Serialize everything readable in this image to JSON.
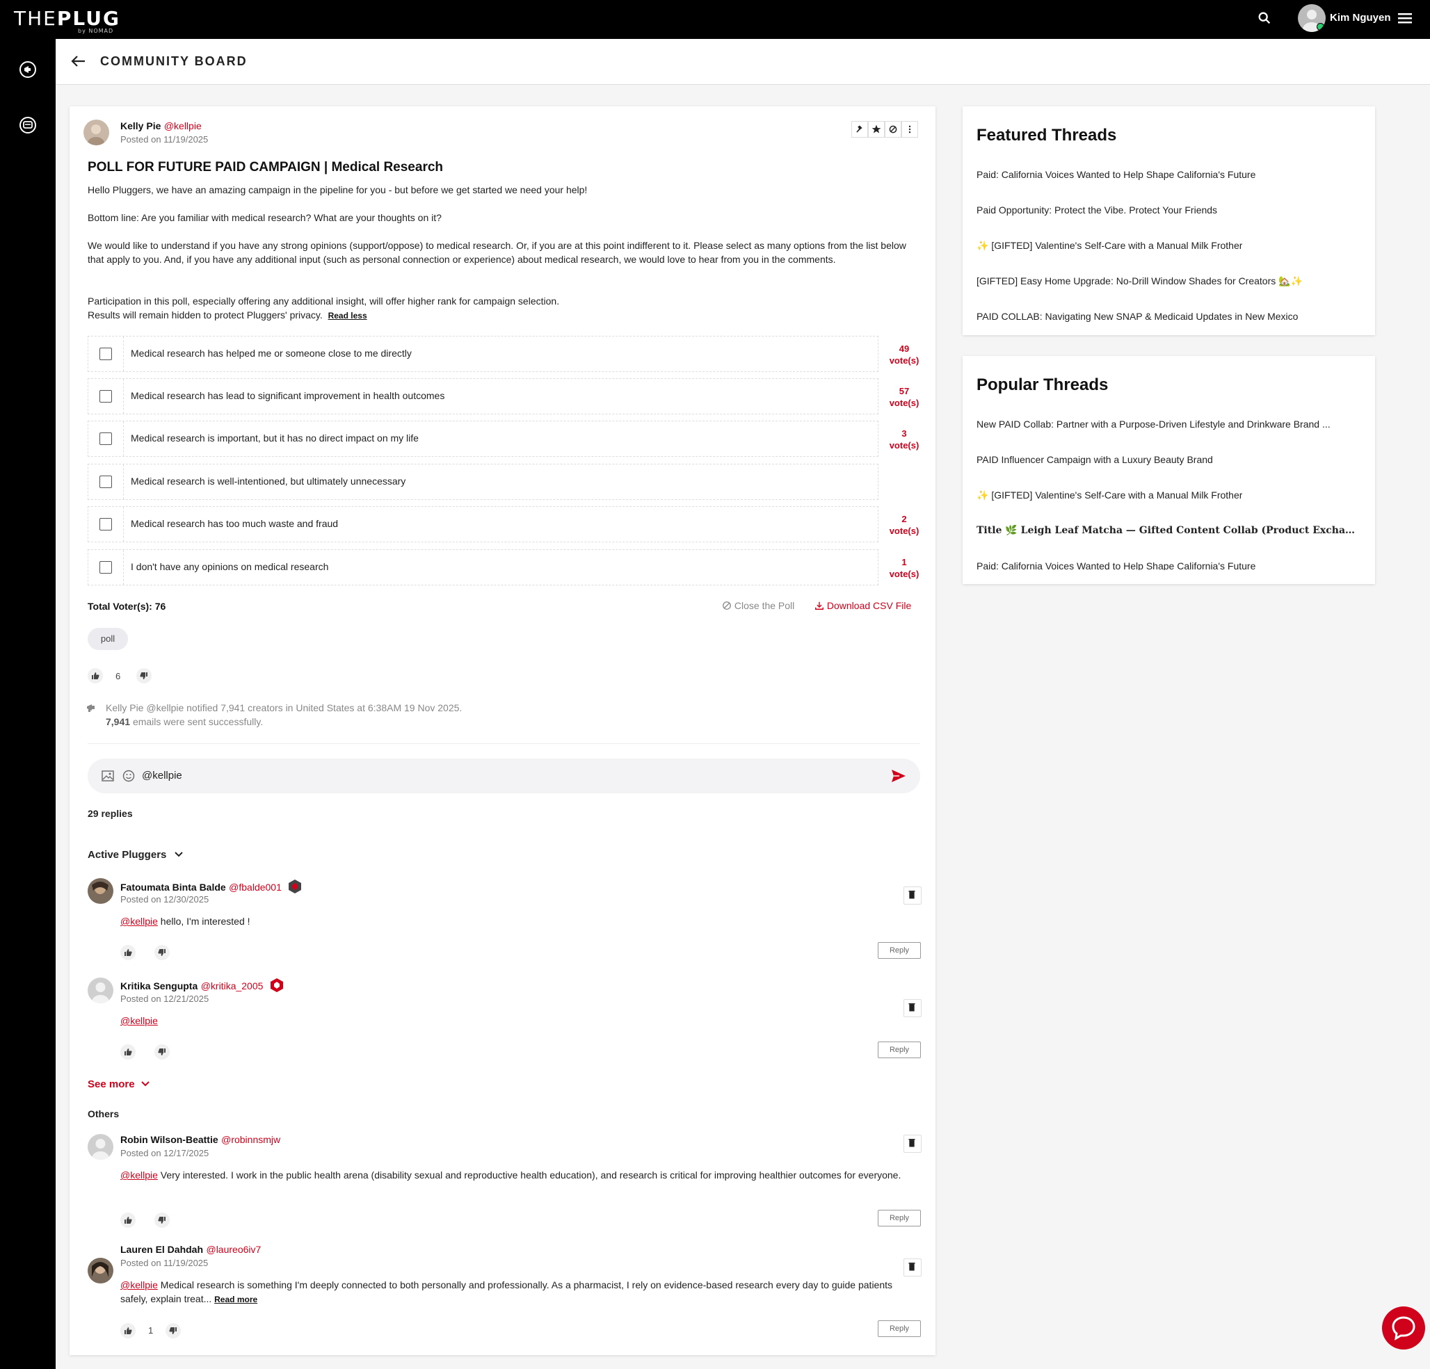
{
  "app": {
    "logo_the": "THE",
    "logo_plug": "PLUG",
    "logo_sub": "by NOMAD",
    "user_name": "Kim Nguyen"
  },
  "header": {
    "title": "COMMUNITY BOARD"
  },
  "post": {
    "author": "Kelly Pie",
    "handle": "@kellpie",
    "posted": "Posted on 11/19/2025",
    "title": "POLL FOR FUTURE PAID CAMPAIGN | Medical Research",
    "p1": "Hello Pluggers, we have an amazing campaign in the pipeline for you - but before we get started we need your help!",
    "p2": "Bottom line: Are you familiar with medical research? What are your thoughts on it?",
    "p3": "We would like to understand if you have any strong opinions (support/oppose) to medical research. Or, if you are at this point indifferent to it. Please select as many options from the list below that apply to you. And, if you have any additional input (such as personal connection or experience) about medical research, we would love to hear from you in the comments.",
    "p4": "Participation in this poll, especially offering any additional insight, will offer higher rank for campaign selection.",
    "p5": "Results will remain hidden to protect Pluggers' privacy.",
    "read_less": "Read less",
    "poll_options": [
      {
        "label": "Medical research has helped me or someone close to me directly",
        "votes": "49",
        "votes_unit": "vote(s)"
      },
      {
        "label": "Medical research has lead to significant improvement in health outcomes",
        "votes": "57",
        "votes_unit": "vote(s)"
      },
      {
        "label": "Medical research is important, but it has no direct impact on my life",
        "votes": "3",
        "votes_unit": "vote(s)"
      },
      {
        "label": "Medical research is well-intentioned, but ultimately unnecessary",
        "votes": "",
        "votes_unit": ""
      },
      {
        "label": "Medical research has too much waste and fraud",
        "votes": "2",
        "votes_unit": "vote(s)"
      },
      {
        "label": "I don't have any opinions on medical research",
        "votes": "1",
        "votes_unit": "vote(s)"
      }
    ],
    "total_voters": "Total Voter(s): 76",
    "close_poll": "Close the Poll",
    "download_csv": "Download CSV File",
    "tag": "poll",
    "likes": "6",
    "notify_line1": "Kelly Pie @kellpie notified 7,941 creators in United States at 6:38AM 19 Nov 2025.",
    "notify_count": "7,941",
    "notify_line2": "emails were sent successfully.",
    "comment_value": "@kellpie",
    "replies_count": "29 replies"
  },
  "comments": {
    "active_heading": "Active Pluggers",
    "others_heading": "Others",
    "see_more": "See more",
    "reply_label": "Reply",
    "read_more": "Read more",
    "active": [
      {
        "name": "Fatoumata Binta Balde",
        "handle": "@fbalde001",
        "posted": "Posted on 12/30/2025",
        "mention": "@kellpie",
        "text": "hello, I'm interested !"
      },
      {
        "name": "Kritika Sengupta",
        "handle": "@kritika_2005",
        "posted": "Posted on 12/21/2025",
        "mention": "@kellpie",
        "text": ""
      }
    ],
    "others": [
      {
        "name": "Robin Wilson-Beattie",
        "handle": "@robinnsmjw",
        "posted": "Posted on 12/17/2025",
        "mention": "@kellpie",
        "text": "Very interested.  I work in the public health arena (disability sexual and reproductive health education), and research is critical for improving healthier outcomes for everyone."
      },
      {
        "name": "Lauren El Dahdah",
        "handle": "@laureo6iv7",
        "posted": "Posted on 11/19/2025",
        "mention": "@kellpie",
        "text": "Medical research is something I'm deeply connected to both personally and professionally. As a pharmacist, I rely on evidence-based research every day to guide patients safely, explain treat...",
        "likes": "1"
      }
    ]
  },
  "featured": {
    "title": "Featured Threads",
    "items": [
      "Paid: California Voices Wanted to Help Shape California's Future",
      "Paid Opportunity: Protect the Vibe. Protect Your Friends",
      "✨ [GIFTED] Valentine's Self-Care with a Manual Milk Frother",
      "[GIFTED] Easy Home Upgrade: No-Drill Window Shades for Creators 🏡✨",
      "PAID COLLAB: Navigating New SNAP & Medicaid Updates in New Mexico"
    ]
  },
  "popular": {
    "title": "Popular Threads",
    "items": [
      "New PAID Collab: Partner with a Purpose-Driven Lifestyle and Drinkware Brand ...",
      "PAID Influencer Campaign with a Luxury Beauty Brand",
      "✨ [GIFTED] Valentine's Self-Care with a Manual Milk Frother",
      "Title 🌿 Leigh Leaf Matcha — Gifted Content Collab (Product Exchange)",
      "Paid: California Voices Wanted to Help Shape California's Future"
    ]
  },
  "colors": {
    "accent": "#d0021b",
    "topbar": "#000000"
  }
}
